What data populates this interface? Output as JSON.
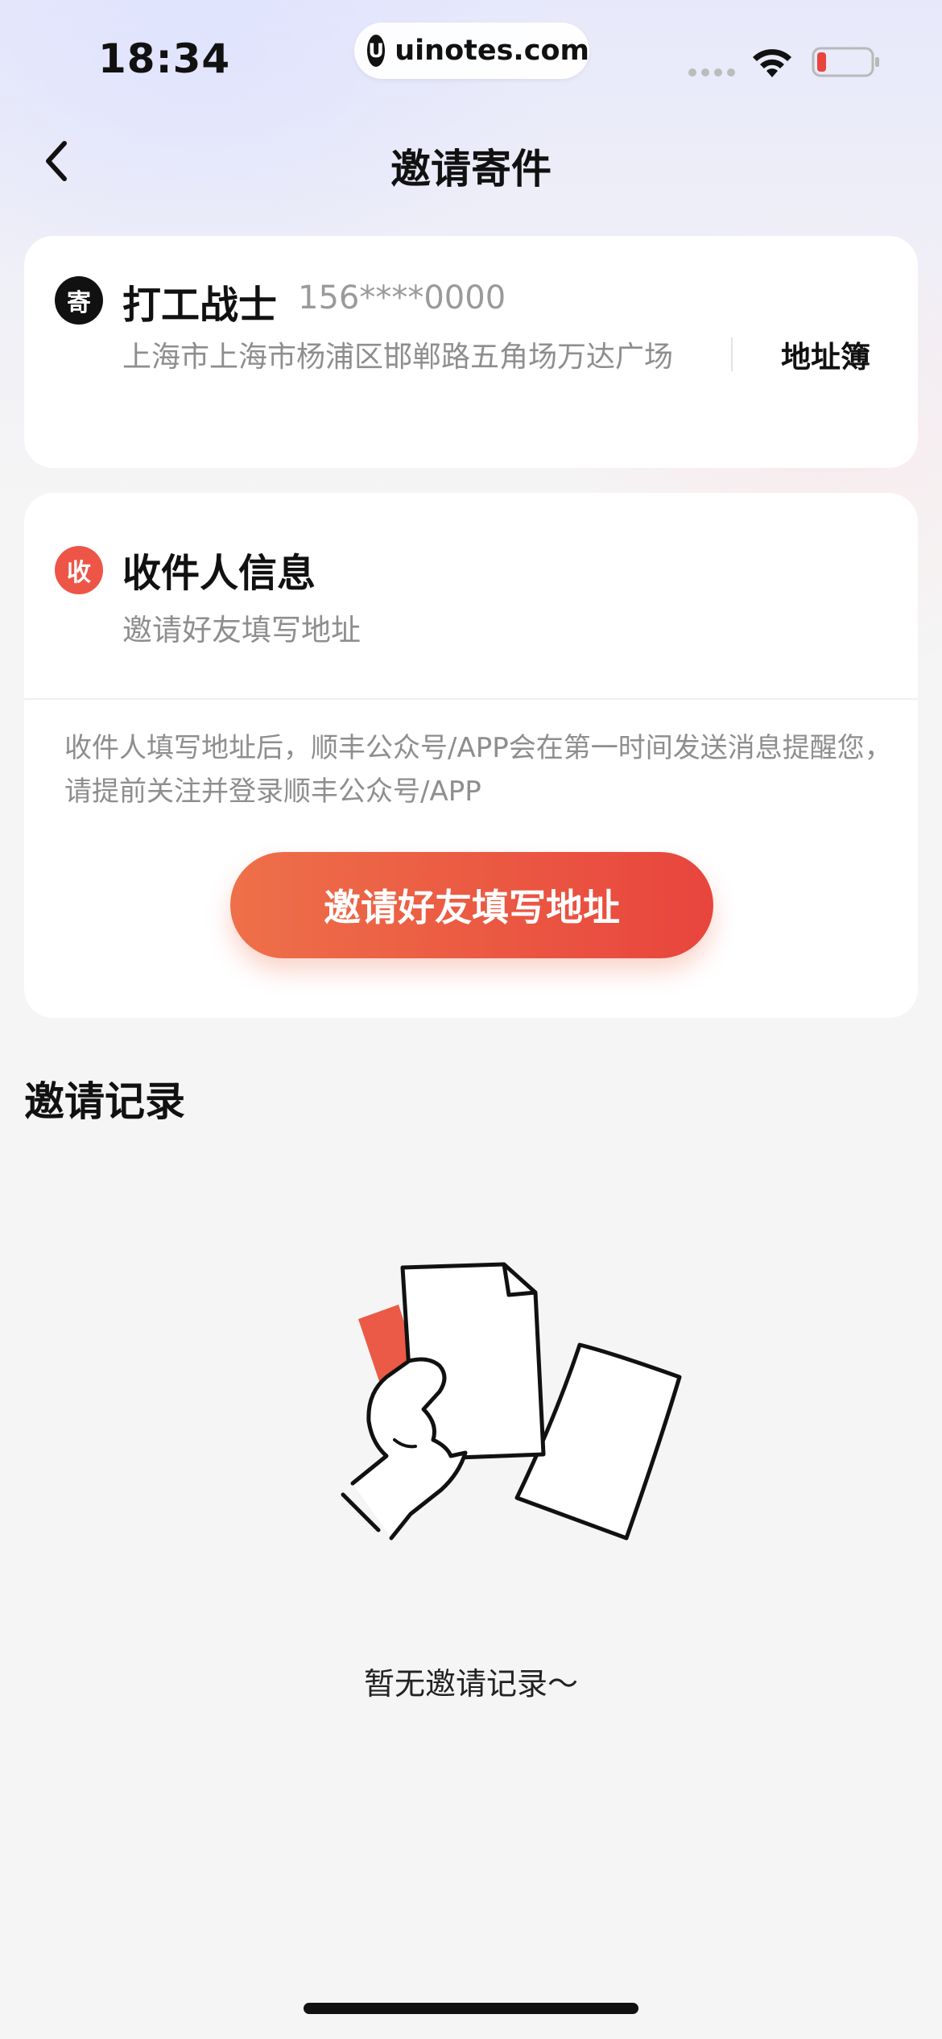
{
  "status_bar": {
    "time": "18:34",
    "url_logo": "U",
    "url": "uinotes.com",
    "icons": [
      "cellular-signal-icon",
      "wifi-icon",
      "battery-low-icon"
    ]
  },
  "nav": {
    "back_icon": "chevron-left-icon",
    "title": "邀请寄件"
  },
  "sender": {
    "badge": "寄",
    "name": "打工战士",
    "phone": "156****0000",
    "address": "上海市上海市杨浦区邯郸路五角场万达广场",
    "address_book_label": "地址簿"
  },
  "receiver": {
    "badge": "收",
    "title": "收件人信息",
    "subtitle": "邀请好友填写地址",
    "notice": "收件人填写地址后，顺丰公众号/APP会在第一时间发送消息提醒您，请提前关注并登录顺丰公众号/APP",
    "invite_button_label": "邀请好友填写地址"
  },
  "records": {
    "title": "邀请记录",
    "empty_icon": "hand-holding-documents-icon",
    "empty_text": "暂无邀请记录～"
  },
  "colors": {
    "accent_start": "#ee7049",
    "accent_end": "#e8453d",
    "receive_badge": "#ed5547",
    "battery_low": "#e8453d"
  }
}
